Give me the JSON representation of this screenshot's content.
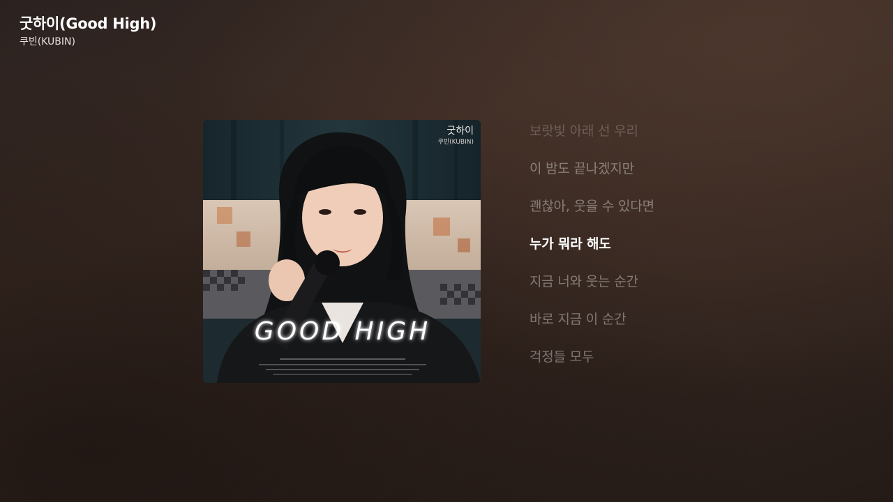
{
  "now_playing": {
    "title": "굿하이(Good High)",
    "artist": "쿠빈(KUBIN)"
  },
  "album_art": {
    "title_text": "굿하이",
    "artist_text": "쿠빈(KUBIN)",
    "logo_text": "GOOD HIGH"
  },
  "lyrics": {
    "lines": [
      "보랏빛 아래 선 우리",
      "이 밤도 끝나겠지만",
      "괜찮아, 웃을 수 있다면",
      "누가 뭐라 해도",
      "지금 너와 웃는 순간",
      "바로 지금 이 순간",
      "걱정들 모두"
    ],
    "active_index": 3
  },
  "colors": {
    "background": "#33251f",
    "active_lyric": "#ffffff",
    "inactive_lyric": "rgba(255,255,255,0.38)"
  }
}
